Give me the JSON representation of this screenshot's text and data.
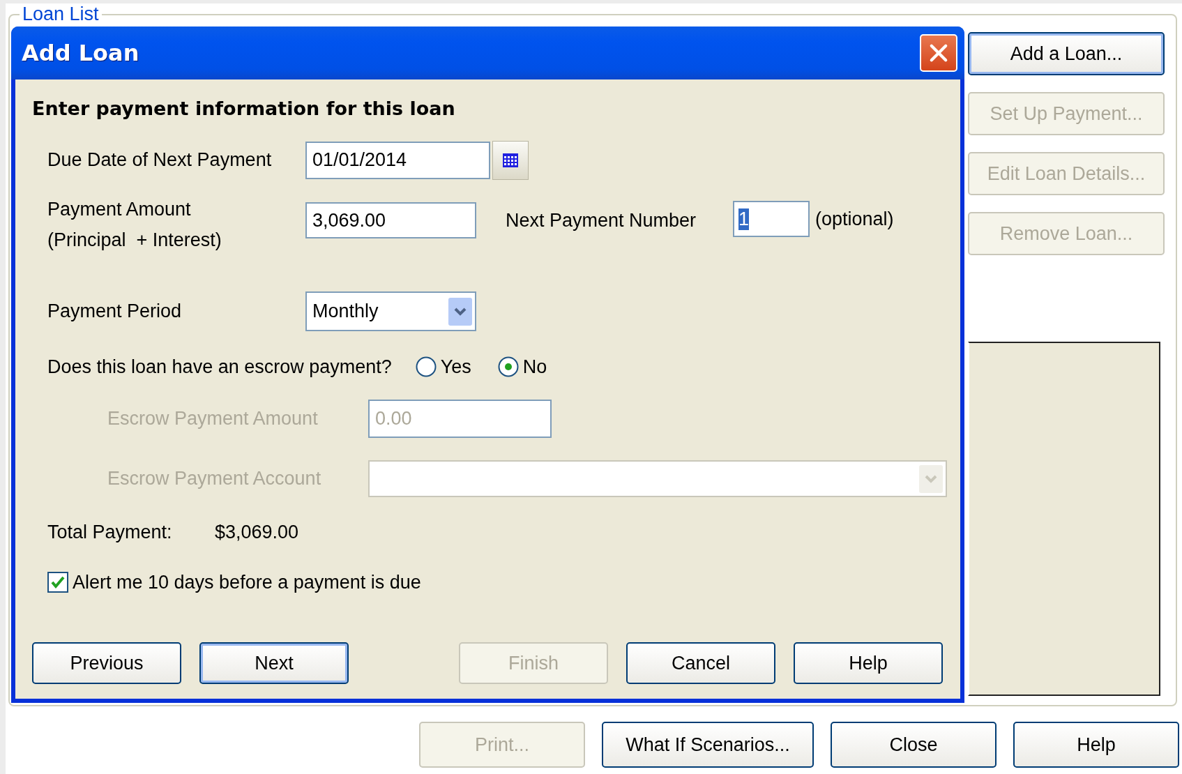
{
  "background_window": {
    "group_title": "Loan List",
    "side_buttons": [
      {
        "label": "Add a Loan...",
        "disabled": false,
        "default": true
      },
      {
        "label": "Set Up Payment...",
        "disabled": true,
        "default": false
      },
      {
        "label": "Edit Loan Details...",
        "disabled": true,
        "default": false
      },
      {
        "label": "Remove Loan...",
        "disabled": true,
        "default": false
      }
    ],
    "footer_buttons": [
      {
        "label": "Print...",
        "disabled": true
      },
      {
        "label": "What If Scenarios...",
        "disabled": false
      },
      {
        "label": "Close",
        "disabled": false
      },
      {
        "label": "Help",
        "disabled": false
      }
    ]
  },
  "dialog": {
    "title": "Add Loan",
    "heading": "Enter payment information for this loan",
    "due_date": {
      "label": "Due Date of Next Payment",
      "value": "01/01/2014"
    },
    "payment_amount": {
      "label_lines": [
        "Payment Amount",
        "(Principal  + Interest)"
      ],
      "value": "3,069.00"
    },
    "next_payment_number": {
      "label": "Next Payment Number",
      "value": "1",
      "highlighted": true,
      "hint": "(optional)"
    },
    "payment_period": {
      "label": "Payment Period",
      "value": "Monthly"
    },
    "escrow_question": {
      "label": "Does this loan have an escrow payment?",
      "options": [
        {
          "label": "Yes",
          "selected": false
        },
        {
          "label": "No",
          "selected": true
        }
      ]
    },
    "escrow_amount": {
      "label": "Escrow Payment Amount",
      "value": "0.00",
      "disabled": true
    },
    "escrow_account": {
      "label": "Escrow Payment Account",
      "disabled": true
    },
    "total": {
      "label": "Total Payment:",
      "value": "$3,069.00"
    },
    "alert": {
      "label": "Alert me 10 days before a payment is due",
      "checked": true
    },
    "buttons": [
      {
        "label": "Previous",
        "disabled": false,
        "default": false
      },
      {
        "label": "Next",
        "disabled": false,
        "default": true
      },
      {
        "label": "Finish",
        "disabled": true,
        "default": false
      },
      {
        "label": "Cancel",
        "disabled": false,
        "default": false
      },
      {
        "label": "Help",
        "disabled": false,
        "default": false
      }
    ]
  }
}
